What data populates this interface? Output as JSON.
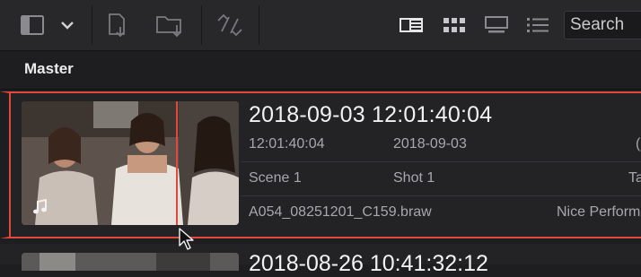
{
  "toolbar": {
    "icons": [
      "sidebar-toggle-icon",
      "chevron-down-icon",
      "import-clip-icon",
      "import-folder-icon",
      "sync-icon",
      "metadata-view-icon",
      "thumbnail-view-icon",
      "strip-view-icon",
      "list-view-icon"
    ],
    "search_label": "Search"
  },
  "bin": {
    "title": "Master"
  },
  "clips": [
    {
      "title": "2018-09-03  12:01:40:04",
      "timecode": "12:01:40:04",
      "date": "2018-09-03",
      "col3_partial": "(",
      "scene": "Scene 1",
      "shot": "Shot 1",
      "take_partial": "Ta",
      "filename": "A054_08251201_C159.braw",
      "comment_partial": "Nice Perform",
      "selected": true,
      "has_audio": true
    },
    {
      "title": "2018-08-26  10:41:32:12"
    }
  ],
  "colors": {
    "selection": "#e2483c",
    "background": "#1e1e20",
    "toolbar": "#28282b"
  }
}
